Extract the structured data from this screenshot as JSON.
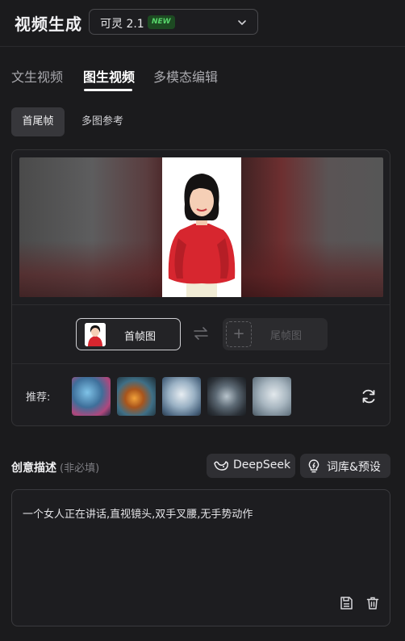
{
  "header": {
    "title": "视频生成",
    "model_select": {
      "selected": "可灵 2.1",
      "badge": "NEW"
    }
  },
  "tabs": [
    {
      "label": "文生视频",
      "active": false
    },
    {
      "label": "图生视频",
      "active": true
    },
    {
      "label": "多模态编辑",
      "active": false
    }
  ],
  "subtabs": [
    {
      "label": "首尾帧",
      "active": true
    },
    {
      "label": "多图参考",
      "active": false
    }
  ],
  "frames": {
    "first_label": "首帧图",
    "last_label": "尾帧图"
  },
  "recommend": {
    "label": "推荐:",
    "thumbnails": [
      "recommend-thumb-1",
      "recommend-thumb-2",
      "recommend-thumb-3",
      "recommend-thumb-4",
      "recommend-thumb-5"
    ]
  },
  "description": {
    "title": "创意描述",
    "subtitle": "(非必填)",
    "deepseek_label": "DeepSeek",
    "library_label": "词库&预设",
    "text": "一个女人正在讲话,直视镜头,双手叉腰,无手势动作"
  },
  "colors": {
    "background": "#1b1b1d",
    "badge_bg": "#1d4a22",
    "badge_text": "#57d66b",
    "portrait_shirt": "#d7262f"
  },
  "icons": [
    "chevron-down-icon",
    "swap-icon",
    "plus-icon",
    "refresh-icon",
    "deepseek-whale-icon",
    "lightbulb-icon",
    "save-icon",
    "trash-icon"
  ]
}
